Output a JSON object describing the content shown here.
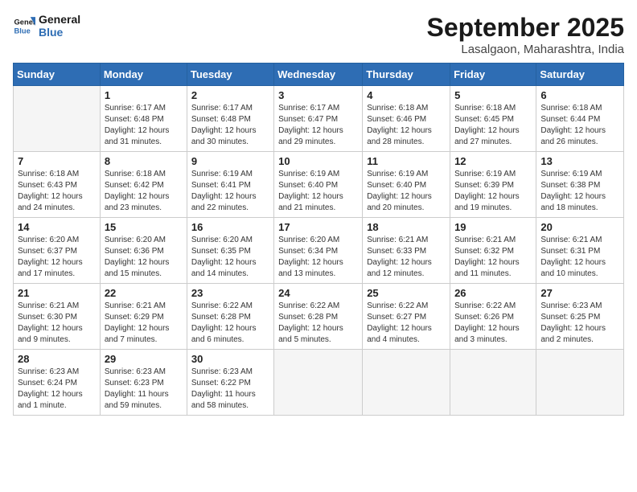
{
  "logo": {
    "line1": "General",
    "line2": "Blue"
  },
  "title": "September 2025",
  "subtitle": "Lasalgaon, Maharashtra, India",
  "weekdays": [
    "Sunday",
    "Monday",
    "Tuesday",
    "Wednesday",
    "Thursday",
    "Friday",
    "Saturday"
  ],
  "weeks": [
    [
      {
        "day": "",
        "sunrise": "",
        "sunset": "",
        "daylight": ""
      },
      {
        "day": "1",
        "sunrise": "Sunrise: 6:17 AM",
        "sunset": "Sunset: 6:48 PM",
        "daylight": "Daylight: 12 hours and 31 minutes."
      },
      {
        "day": "2",
        "sunrise": "Sunrise: 6:17 AM",
        "sunset": "Sunset: 6:48 PM",
        "daylight": "Daylight: 12 hours and 30 minutes."
      },
      {
        "day": "3",
        "sunrise": "Sunrise: 6:17 AM",
        "sunset": "Sunset: 6:47 PM",
        "daylight": "Daylight: 12 hours and 29 minutes."
      },
      {
        "day": "4",
        "sunrise": "Sunrise: 6:18 AM",
        "sunset": "Sunset: 6:46 PM",
        "daylight": "Daylight: 12 hours and 28 minutes."
      },
      {
        "day": "5",
        "sunrise": "Sunrise: 6:18 AM",
        "sunset": "Sunset: 6:45 PM",
        "daylight": "Daylight: 12 hours and 27 minutes."
      },
      {
        "day": "6",
        "sunrise": "Sunrise: 6:18 AM",
        "sunset": "Sunset: 6:44 PM",
        "daylight": "Daylight: 12 hours and 26 minutes."
      }
    ],
    [
      {
        "day": "7",
        "sunrise": "Sunrise: 6:18 AM",
        "sunset": "Sunset: 6:43 PM",
        "daylight": "Daylight: 12 hours and 24 minutes."
      },
      {
        "day": "8",
        "sunrise": "Sunrise: 6:18 AM",
        "sunset": "Sunset: 6:42 PM",
        "daylight": "Daylight: 12 hours and 23 minutes."
      },
      {
        "day": "9",
        "sunrise": "Sunrise: 6:19 AM",
        "sunset": "Sunset: 6:41 PM",
        "daylight": "Daylight: 12 hours and 22 minutes."
      },
      {
        "day": "10",
        "sunrise": "Sunrise: 6:19 AM",
        "sunset": "Sunset: 6:40 PM",
        "daylight": "Daylight: 12 hours and 21 minutes."
      },
      {
        "day": "11",
        "sunrise": "Sunrise: 6:19 AM",
        "sunset": "Sunset: 6:40 PM",
        "daylight": "Daylight: 12 hours and 20 minutes."
      },
      {
        "day": "12",
        "sunrise": "Sunrise: 6:19 AM",
        "sunset": "Sunset: 6:39 PM",
        "daylight": "Daylight: 12 hours and 19 minutes."
      },
      {
        "day": "13",
        "sunrise": "Sunrise: 6:19 AM",
        "sunset": "Sunset: 6:38 PM",
        "daylight": "Daylight: 12 hours and 18 minutes."
      }
    ],
    [
      {
        "day": "14",
        "sunrise": "Sunrise: 6:20 AM",
        "sunset": "Sunset: 6:37 PM",
        "daylight": "Daylight: 12 hours and 17 minutes."
      },
      {
        "day": "15",
        "sunrise": "Sunrise: 6:20 AM",
        "sunset": "Sunset: 6:36 PM",
        "daylight": "Daylight: 12 hours and 15 minutes."
      },
      {
        "day": "16",
        "sunrise": "Sunrise: 6:20 AM",
        "sunset": "Sunset: 6:35 PM",
        "daylight": "Daylight: 12 hours and 14 minutes."
      },
      {
        "day": "17",
        "sunrise": "Sunrise: 6:20 AM",
        "sunset": "Sunset: 6:34 PM",
        "daylight": "Daylight: 12 hours and 13 minutes."
      },
      {
        "day": "18",
        "sunrise": "Sunrise: 6:21 AM",
        "sunset": "Sunset: 6:33 PM",
        "daylight": "Daylight: 12 hours and 12 minutes."
      },
      {
        "day": "19",
        "sunrise": "Sunrise: 6:21 AM",
        "sunset": "Sunset: 6:32 PM",
        "daylight": "Daylight: 12 hours and 11 minutes."
      },
      {
        "day": "20",
        "sunrise": "Sunrise: 6:21 AM",
        "sunset": "Sunset: 6:31 PM",
        "daylight": "Daylight: 12 hours and 10 minutes."
      }
    ],
    [
      {
        "day": "21",
        "sunrise": "Sunrise: 6:21 AM",
        "sunset": "Sunset: 6:30 PM",
        "daylight": "Daylight: 12 hours and 9 minutes."
      },
      {
        "day": "22",
        "sunrise": "Sunrise: 6:21 AM",
        "sunset": "Sunset: 6:29 PM",
        "daylight": "Daylight: 12 hours and 7 minutes."
      },
      {
        "day": "23",
        "sunrise": "Sunrise: 6:22 AM",
        "sunset": "Sunset: 6:28 PM",
        "daylight": "Daylight: 12 hours and 6 minutes."
      },
      {
        "day": "24",
        "sunrise": "Sunrise: 6:22 AM",
        "sunset": "Sunset: 6:28 PM",
        "daylight": "Daylight: 12 hours and 5 minutes."
      },
      {
        "day": "25",
        "sunrise": "Sunrise: 6:22 AM",
        "sunset": "Sunset: 6:27 PM",
        "daylight": "Daylight: 12 hours and 4 minutes."
      },
      {
        "day": "26",
        "sunrise": "Sunrise: 6:22 AM",
        "sunset": "Sunset: 6:26 PM",
        "daylight": "Daylight: 12 hours and 3 minutes."
      },
      {
        "day": "27",
        "sunrise": "Sunrise: 6:23 AM",
        "sunset": "Sunset: 6:25 PM",
        "daylight": "Daylight: 12 hours and 2 minutes."
      }
    ],
    [
      {
        "day": "28",
        "sunrise": "Sunrise: 6:23 AM",
        "sunset": "Sunset: 6:24 PM",
        "daylight": "Daylight: 12 hours and 1 minute."
      },
      {
        "day": "29",
        "sunrise": "Sunrise: 6:23 AM",
        "sunset": "Sunset: 6:23 PM",
        "daylight": "Daylight: 11 hours and 59 minutes."
      },
      {
        "day": "30",
        "sunrise": "Sunrise: 6:23 AM",
        "sunset": "Sunset: 6:22 PM",
        "daylight": "Daylight: 11 hours and 58 minutes."
      },
      {
        "day": "",
        "sunrise": "",
        "sunset": "",
        "daylight": ""
      },
      {
        "day": "",
        "sunrise": "",
        "sunset": "",
        "daylight": ""
      },
      {
        "day": "",
        "sunrise": "",
        "sunset": "",
        "daylight": ""
      },
      {
        "day": "",
        "sunrise": "",
        "sunset": "",
        "daylight": ""
      }
    ]
  ]
}
